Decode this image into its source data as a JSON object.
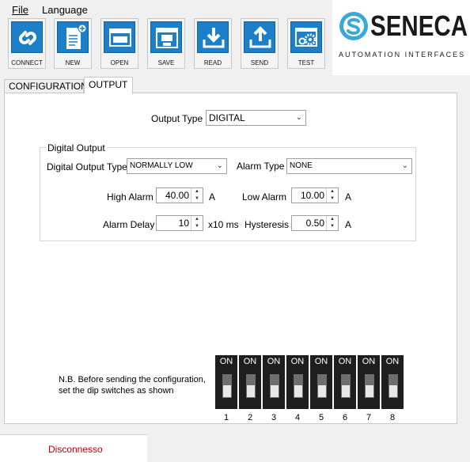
{
  "menu": {
    "file_label": "File",
    "language_label": "Language"
  },
  "toolbar": [
    {
      "id": "connect",
      "label": "CONNECT",
      "icon": "connect-icon"
    },
    {
      "id": "new",
      "label": "NEW",
      "icon": "new-file-icon"
    },
    {
      "id": "open",
      "label": "OPEN",
      "icon": "open-window-icon"
    },
    {
      "id": "save",
      "label": "SAVE",
      "icon": "save-disk-icon"
    },
    {
      "id": "read",
      "label": "READ",
      "icon": "download-icon"
    },
    {
      "id": "send",
      "label": "SEND",
      "icon": "upload-icon"
    },
    {
      "id": "test",
      "label": "TEST",
      "icon": "gears-icon"
    }
  ],
  "logo": {
    "name": "SENECA",
    "subtitle": "AUTOMATION INTERFACES",
    "accent": "#3aa8d8"
  },
  "tabs": [
    {
      "label": "CONFIGURATION"
    },
    {
      "label": "OUTPUT",
      "active": true
    }
  ],
  "output": {
    "output_type_label": "Output Type",
    "output_type_value": "DIGITAL",
    "group_title": "Digital Output",
    "digital_output_type_label": "Digital Output Type",
    "digital_output_type_value": "NORMALLY LOW",
    "alarm_type_label": "Alarm Type",
    "alarm_type_value": "NONE",
    "high_alarm_label": "High Alarm",
    "high_alarm_value": "40.00",
    "high_alarm_unit": "A",
    "low_alarm_label": "Low Alarm",
    "low_alarm_value": "10.00",
    "low_alarm_unit": "A",
    "alarm_delay_label": "Alarm Delay",
    "alarm_delay_value": "10",
    "alarm_delay_unit": "x10 ms",
    "hysteresis_label": "Hysteresis",
    "hysteresis_value": "0.50",
    "hysteresis_unit": "A"
  },
  "dip": {
    "note_line1": "N.B. Before sending the configuration,",
    "note_line2": "set the dip switches as shown",
    "switches": [
      {
        "number": "1",
        "on_label": "ON",
        "state": "off"
      },
      {
        "number": "2",
        "on_label": "ON",
        "state": "off"
      },
      {
        "number": "3",
        "on_label": "ON",
        "state": "off"
      },
      {
        "number": "4",
        "on_label": "ON",
        "state": "off"
      },
      {
        "number": "5",
        "on_label": "ON",
        "state": "off"
      },
      {
        "number": "6",
        "on_label": "ON",
        "state": "off"
      },
      {
        "number": "7",
        "on_label": "ON",
        "state": "off"
      },
      {
        "number": "8",
        "on_label": "ON",
        "state": "off"
      }
    ]
  },
  "status": {
    "text": "Disconnesso",
    "color": "#c00000"
  }
}
